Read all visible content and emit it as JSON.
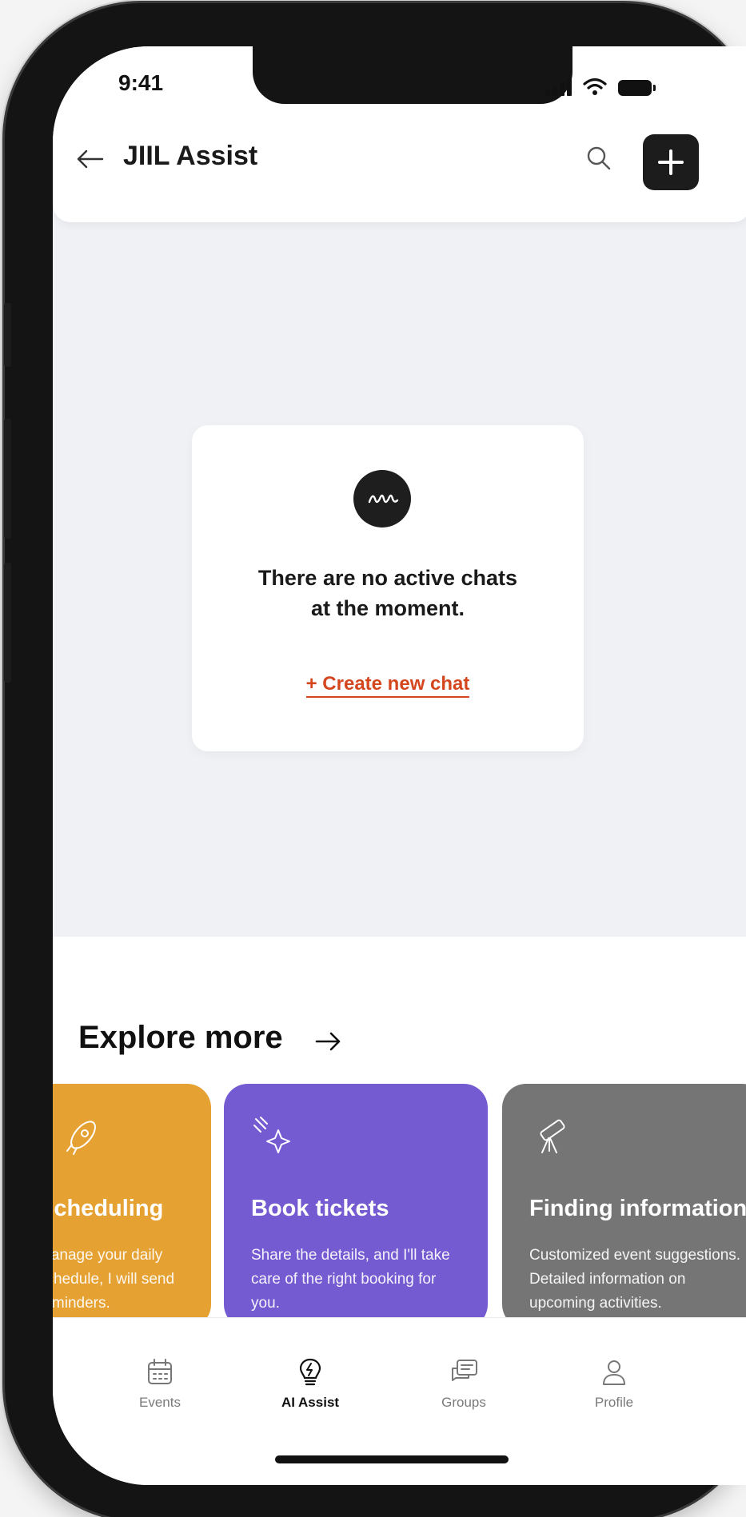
{
  "status_bar": {
    "time": "9:41"
  },
  "header": {
    "title": "JIIL Assist"
  },
  "empty_state": {
    "line1": "There are no active chats",
    "line2": "at the moment.",
    "create_link": "+ Create new chat"
  },
  "explore": {
    "title": "Explore more",
    "cards": [
      {
        "title": "Scheduling",
        "description": "Manage your daily schedule, I will send reminders.",
        "color": "#e6a133",
        "icon": "rocket-icon"
      },
      {
        "title": "Book tickets",
        "description": "Share the details, and I'll take care of the right booking for you.",
        "color": "#745bd1",
        "icon": "sparkle-icon"
      },
      {
        "title": "Finding information",
        "description": "Customized event suggestions. Detailed information on upcoming activities.",
        "color": "#757575",
        "icon": "telescope-icon"
      }
    ]
  },
  "tab_bar": {
    "tabs": [
      {
        "label": "Events",
        "icon": "calendar-icon",
        "active": false
      },
      {
        "label": "AI Assist",
        "icon": "lightbulb-icon",
        "active": true
      },
      {
        "label": "Groups",
        "icon": "chat-bubbles-icon",
        "active": false
      },
      {
        "label": "Profile",
        "icon": "person-icon",
        "active": false
      }
    ]
  },
  "colors": {
    "accent_link": "#d4461e",
    "primary_dark": "#1c1c1c",
    "background": "#eff1f4"
  }
}
